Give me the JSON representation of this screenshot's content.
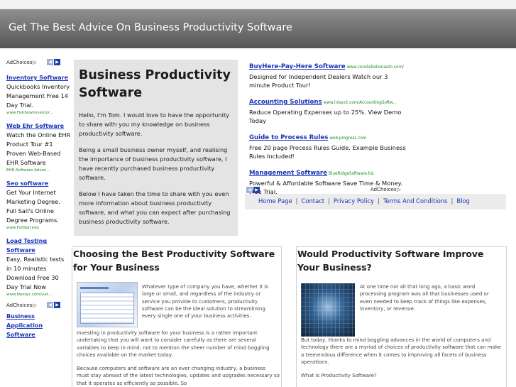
{
  "banner": {
    "title": "Get The Best Advice On Business Productivity Software"
  },
  "left_ads": {
    "adchoices_label": "AdChoices",
    "ads": [
      {
        "title": "Inventory Software",
        "desc": "Quickbooks Inventory Management Free 14 Day Trial.",
        "url": "www.Fishbowlinventor..."
      },
      {
        "title": "Web Ehr Software",
        "desc": "Watch the Online EHR Product Tour #1 Proven Web-Based EHR Software",
        "url": "EHR-Software.Advan..."
      },
      {
        "title": "Seo software",
        "desc": "Get Your Internet Marketing Degree. Full Sail's Online Degree Programs.",
        "url": "www.FullSail.edu"
      },
      {
        "title": "Load Testing Software",
        "desc": "Easy, Realistic tests in 10 minutes Download Free 30 Day Trial Now",
        "url": "www.Neotys.com/Get..."
      }
    ],
    "adchoices_label_2": "AdChoices",
    "ad5": {
      "title": "Business Application Software"
    }
  },
  "intro": {
    "title": "Business Productivity Software",
    "paragraphs": [
      "Hello, I'm Tom. I would love to have the opportunity to share with you my knowledge on business productivity software.",
      "Being a small business owner myself, and realising the importance of business productivity software, I have recently purchased business productivity software.",
      "Below I have taken the time to share with you even more information about business productivity software, and what you can expect after purchasing business productivity software."
    ]
  },
  "right_ads": {
    "ads": [
      {
        "title": "BuyHere-Pay-Here Software",
        "url": "www.constellationauto.com/",
        "desc": "Designed for Independent Dealers Watch our 3 minute Product Tour!"
      },
      {
        "title": "Accounting Solutions",
        "url": "www.intacct.com/AccountingSoftw...",
        "desc": "Reduce Operating Expenses up to 25%. View Demo Today"
      },
      {
        "title": "Guide to Process Rules",
        "url": "web.progress.com",
        "desc": "Free 20 page Process Rules Guide. Example Business Rules Included!"
      },
      {
        "title": "Management Software",
        "url": "BlueRidgeSoftware.biz",
        "desc": "Powerful & Affordable Software Save Time & Money. Free Trial."
      }
    ],
    "adchoices_label": "AdChoices"
  },
  "nav": {
    "home": "Home Page",
    "contact": "Contact",
    "privacy": "Privacy Policy",
    "terms": "Terms And Conditions",
    "blog": "Blog",
    "separator": "|"
  },
  "article1": {
    "title": "Choosing the Best Productivity Software for Your Business",
    "side_text": "Whatever type of company you have, whether it is large or small, and regardless of the industry or service you provide to customers, productivity software can be the ideal solution to streamlining every single one of your business activities.",
    "paragraphs": [
      "Investing in productivity software for your business is a rather important undertaking that you will want to consider carefully as there are several variables to keep in mind, not to mention the sheer number of mind boggling choices available on the market today.",
      "Because computers and software are an ever changing industry, a business must stay abreast of the latest technologies, updates and upgrades necessary so that it operates as efficiently as possible. So"
    ]
  },
  "article2": {
    "title": "Would Productivity Software Improve Your Business?",
    "side_text": "At one time not all that long ago, a basic word processing program was all that businesses used or even needed to keep track of things like expenses, inventory, or revenue.",
    "paragraphs": [
      "But today, thanks to mind boggling advances in the world of computers and technology there are a myriad of choices of productivity software that can make a tremendous difference when it comes to improving all facets of business operations.",
      "What is Productivity Software?"
    ]
  }
}
